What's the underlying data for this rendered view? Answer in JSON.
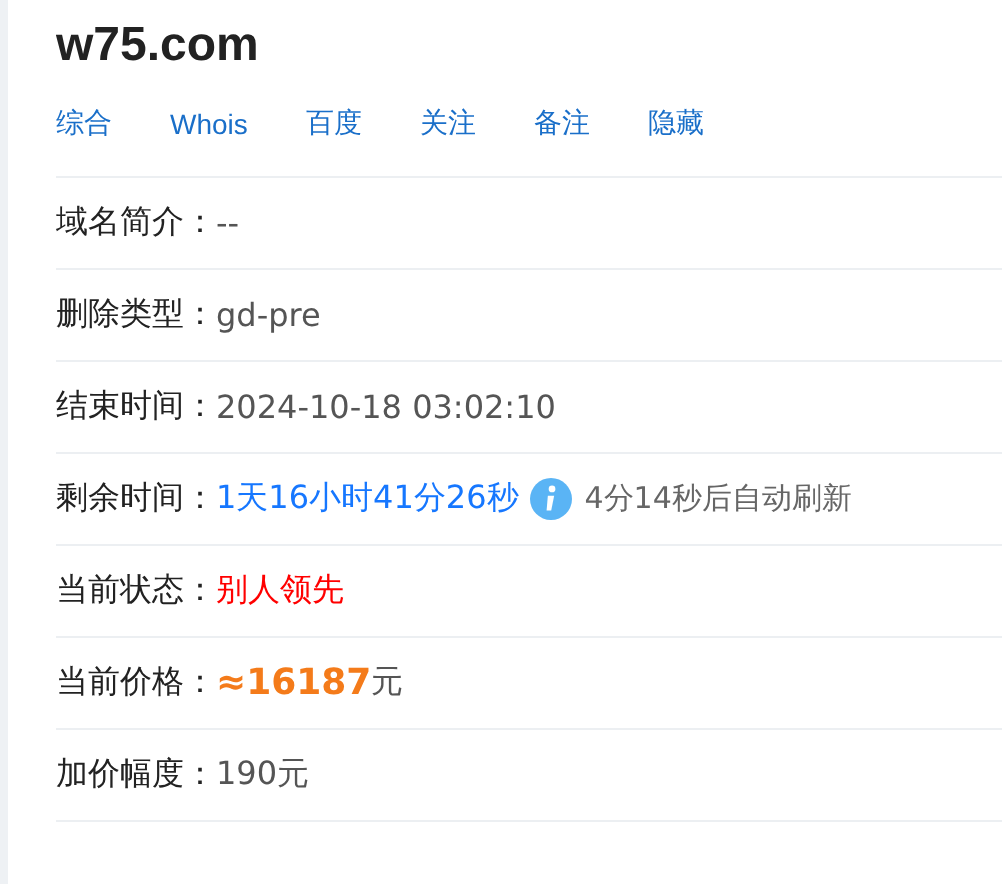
{
  "domain": "w75.com",
  "links": [
    "综合",
    "Whois",
    "百度",
    "关注",
    "备注",
    "隐藏"
  ],
  "rows": [
    {
      "kind": "plain",
      "label": "域名简介：",
      "value": "--"
    },
    {
      "kind": "plain",
      "label": "删除类型：",
      "value": "gd-pre"
    },
    {
      "kind": "plain",
      "label": "结束时间：",
      "value": "2024-10-18 03:02:10"
    },
    {
      "kind": "countdown",
      "label": "剩余时间：",
      "value": "1天16小时41分26秒",
      "note": "4分14秒后自动刷新"
    },
    {
      "kind": "status",
      "label": "当前状态：",
      "value": "别人领先"
    },
    {
      "kind": "price",
      "label": "当前价格：",
      "value": "≈16187",
      "unit": "元"
    },
    {
      "kind": "plain",
      "label": "加价幅度：",
      "value": "190元"
    }
  ]
}
